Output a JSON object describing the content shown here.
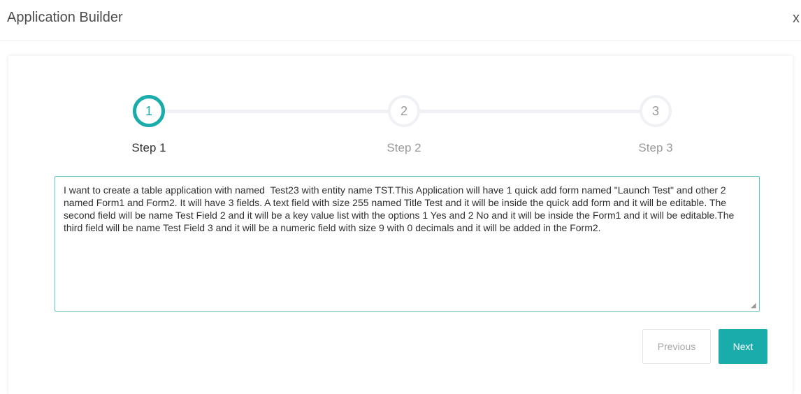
{
  "header": {
    "title": "Application Builder",
    "close_label": "x"
  },
  "stepper": {
    "steps": [
      {
        "number": "1",
        "label": "Step 1",
        "state": "active"
      },
      {
        "number": "2",
        "label": "Step 2",
        "state": "inactive"
      },
      {
        "number": "3",
        "label": "Step 3",
        "state": "inactive"
      }
    ]
  },
  "prompt": {
    "value": "I want to create a table application with named  Test23 with entity name TST.This Application will have 1 quick add form named \"Launch Test\" and other 2 named Form1 and Form2. It will have 3 fields. A text field with size 255 named Title Test and it will be inside the quick add form and it will be editable. The second field will be name Test Field 2 and it will be a key value list with the options 1 Yes and 2 No and it will be inside the Form1 and it will be editable.The third field will be name Test Field 3 and it will be a numeric field with size 9 with 0 decimals and it will be added in the Form2."
  },
  "actions": {
    "previous_label": "Previous",
    "next_label": "Next"
  },
  "colors": {
    "accent": "#1aabab",
    "inactive": "#f0f1f5"
  }
}
